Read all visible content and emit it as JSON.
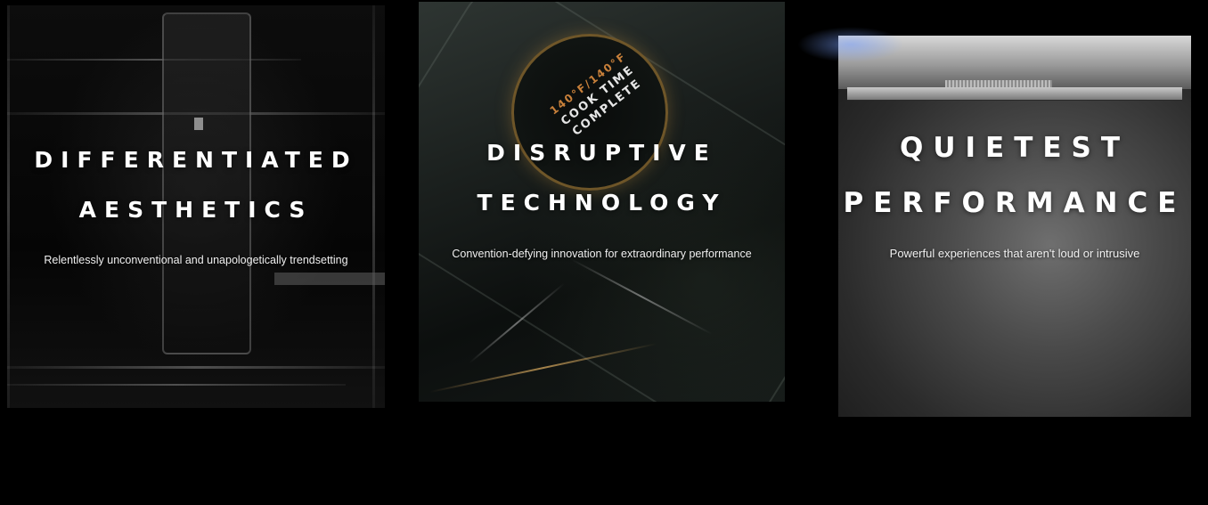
{
  "cards": [
    {
      "heading_line1": "DIFFERENTIATED",
      "heading_line2": "AESTHETICS",
      "subtitle": "Relentlessly unconventional and unapologetically trendsetting"
    },
    {
      "heading_line1": "DISRUPTIVE",
      "heading_line2": "TECHNOLOGY",
      "subtitle": "Convention-defying innovation for extraordinary performance",
      "dial": {
        "temperature": "140°F/140°F",
        "status_line1": "COOK TIME",
        "status_line2": "COMPLETE"
      }
    },
    {
      "heading_line1": "QUIETEST",
      "heading_line2": "PERFORMANCE",
      "subtitle": "Powerful experiences that aren't loud or intrusive"
    }
  ],
  "colors": {
    "background": "#000000",
    "text": "#ffffff",
    "dial_accent": "#c8803a"
  }
}
